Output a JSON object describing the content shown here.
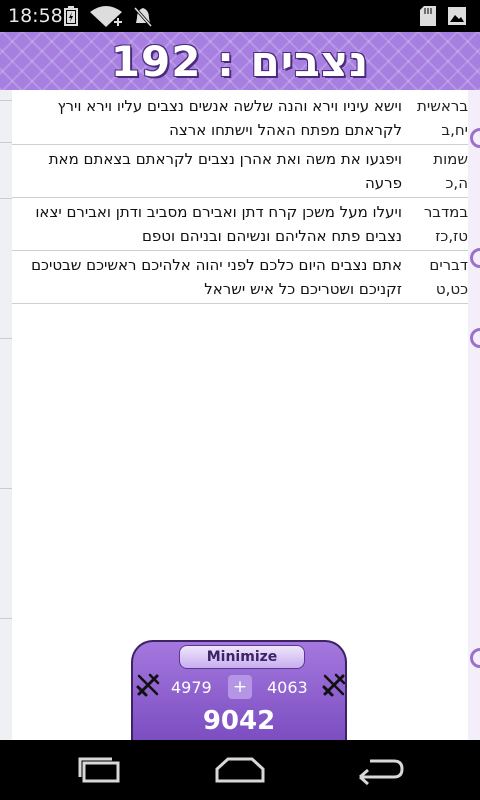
{
  "status_bar": {
    "time": "18:58",
    "left_icons": [
      "battery-charging-icon",
      "wifi-icon",
      "notification-muted-icon"
    ],
    "right_icons": [
      "sd-card-icon",
      "image-icon"
    ]
  },
  "header": {
    "title": "נצבים : 192"
  },
  "verses": [
    {
      "text": "וישא עיניו וירא והנה שלשה אנשים נצבים עליו וירא וירץ לקראתם מפתח האהל וישתחו ארצה",
      "book": "בראשית",
      "chapter_verse": "יח,ב"
    },
    {
      "text": "ויפגעו את משה ואת אהרן נצבים לקראתם בצאתם מאת פרעה",
      "book": "שמות",
      "chapter_verse": "ה,כ"
    },
    {
      "text": "ויעלו מעל משכן קרח דתן ואבירם מסביב ודתן ואבירם יצאו נצבים פתח אהליהם ונשיהם ובניהם וטפם",
      "book": "במדבר",
      "chapter_verse": "טז,כז"
    },
    {
      "text": "אתם נצבים היום כלכם לפני יהוה אלהיכם ראשיכם שבטיכם זקניכם ושטריכם כל איש ישראל",
      "book": "דברים",
      "chapter_verse": "כט,ט"
    }
  ],
  "counter": {
    "minimize_label": "Minimize",
    "left_value": "4979",
    "plus_label": "+",
    "right_value": "4063",
    "total": "9042",
    "icons": [
      "sword-left-icon",
      "sword-right-icon"
    ]
  },
  "nav_bar": {
    "buttons": [
      "recent-apps-icon",
      "home-icon",
      "back-icon"
    ]
  },
  "colors": {
    "header_purple": "#a77fe0",
    "panel_purple": "#8a5cd0",
    "panel_border": "#3d2266"
  }
}
